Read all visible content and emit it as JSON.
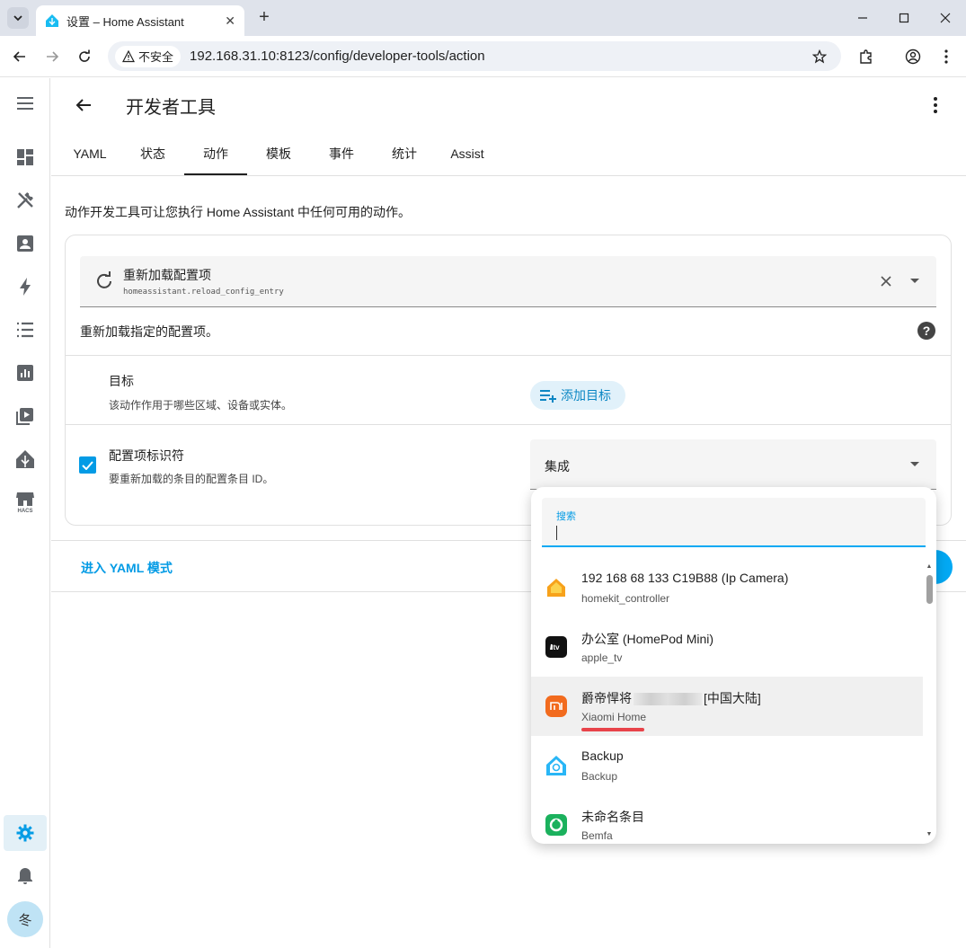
{
  "browser": {
    "tab_title": "设置 – Home Assistant",
    "new_tab": "+",
    "security_label": "不安全",
    "url": "192.168.31.10:8123/config/developer-tools/action"
  },
  "sidebar": {
    "items": [
      "menu-icon",
      "dashboard-icon",
      "tools-icon",
      "person-icon",
      "energy-icon",
      "logbook-icon",
      "history-icon",
      "media-icon",
      "hacs-icon"
    ],
    "avatar": "冬"
  },
  "header": {
    "title": "开发者工具",
    "tabs": [
      "YAML",
      "状态",
      "动作",
      "模板",
      "事件",
      "统计",
      "Assist"
    ],
    "active_tab": "动作"
  },
  "main": {
    "intro": "动作开发工具可让您执行 Home Assistant 中任何可用的动作。",
    "action": {
      "name": "重新加载配置项",
      "id": "homeassistant.reload_config_entry",
      "description": "重新加载指定的配置项。"
    },
    "target": {
      "title": "目标",
      "subtitle": "该动作作用于哪些区域、设备或实体。",
      "add_button": "添加目标"
    },
    "entry": {
      "title": "配置项标识符",
      "subtitle": "要重新加载的条目的配置条目 ID。",
      "select_value": "集成",
      "checked": true
    },
    "yaml_mode": "进入 YAML 模式"
  },
  "dropdown": {
    "search_label": "搜索",
    "search_value": "",
    "items": [
      {
        "title": "192 168 68 133 C19B88 (Ip Camera)",
        "subtitle": "homekit_controller",
        "icon": "homekit-icon"
      },
      {
        "title": "办公室 (HomePod Mini)",
        "subtitle": "apple_tv",
        "icon": "apple-tv-icon"
      },
      {
        "title_pre": "爵帝悍将",
        "title_post": "[中国大陆]",
        "subtitle": "Xiaomi Home",
        "icon": "xiaomi-icon"
      },
      {
        "title": "Backup",
        "subtitle": "Backup",
        "icon": "backup-icon"
      },
      {
        "title": "未命名条目",
        "subtitle": "Bemfa",
        "icon": "bemfa-icon"
      }
    ]
  },
  "colors": {
    "accent": "#03a9f4",
    "checkbox": "#039be5",
    "highlight_underline": "#e8434a"
  }
}
